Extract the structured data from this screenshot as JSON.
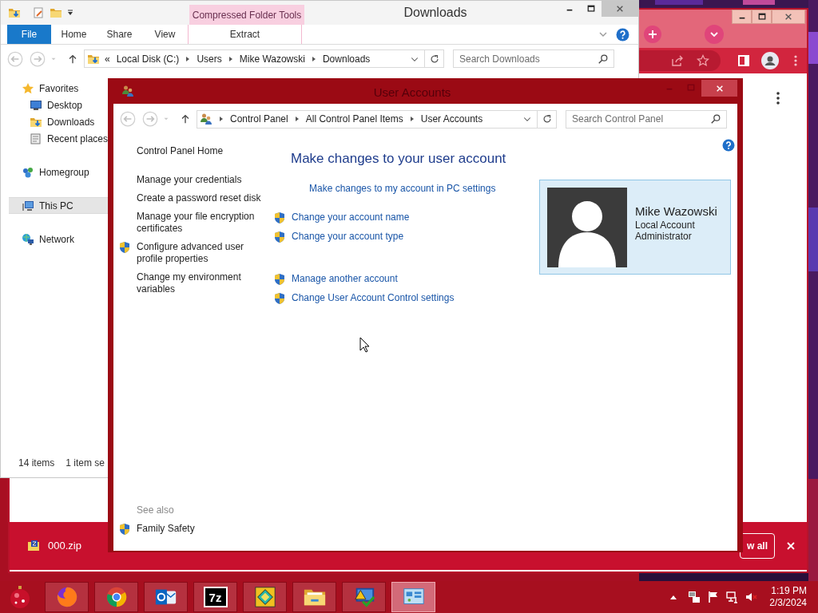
{
  "explorer": {
    "title": "Downloads",
    "contextual_group": "Compressed Folder Tools",
    "ribbon_tabs": [
      {
        "label": "File",
        "kind": "file"
      },
      {
        "label": "Home",
        "kind": "tab"
      },
      {
        "label": "Share",
        "kind": "tab"
      },
      {
        "label": "View",
        "kind": "tab"
      },
      {
        "label": "Extract",
        "kind": "contextual"
      }
    ],
    "address": {
      "overflow": "«",
      "path": [
        "Local Disk (C:)",
        "Users",
        "Mike Wazowski",
        "Downloads"
      ]
    },
    "search": {
      "placeholder": "Search Downloads"
    },
    "nav": [
      {
        "label": "Favorites",
        "kind": "star",
        "selected": false,
        "children": [
          {
            "label": "Desktop",
            "kind": "desktop",
            "selected": false
          },
          {
            "label": "Downloads",
            "kind": "downloads",
            "selected": false
          },
          {
            "label": "Recent places",
            "kind": "recent",
            "selected": false
          }
        ]
      },
      {
        "label": "Homegroup",
        "kind": "homegroup",
        "selected": false
      },
      {
        "label": "This PC",
        "kind": "pc",
        "selected": true
      },
      {
        "label": "Network",
        "kind": "network",
        "selected": false
      }
    ],
    "status": [
      "14 items",
      "1 item se"
    ]
  },
  "browser": {
    "download": {
      "file": "000.zip",
      "button": "w all"
    }
  },
  "user_accounts": {
    "title": "User Accounts",
    "breadcrumb": [
      "Control Panel",
      "All Control Panel Items",
      "User Accounts"
    ],
    "search": {
      "placeholder": "Search Control Panel"
    },
    "tasks": [
      {
        "label": "Control Panel Home",
        "shield": false
      },
      {
        "label": "Manage your credentials",
        "shield": false
      },
      {
        "label": "Create a password reset disk",
        "shield": false
      },
      {
        "label": "Manage your file encryption certificates",
        "shield": false
      },
      {
        "label": "Configure advanced user profile properties",
        "shield": true
      },
      {
        "label": "Change my environment variables",
        "shield": false
      }
    ],
    "heading": "Make changes to your user account",
    "link_groups": [
      [
        {
          "label": "Make changes to my account in PC settings",
          "shield": false
        }
      ],
      [
        {
          "label": "Change your account name",
          "shield": true
        },
        {
          "label": "Change your account type",
          "shield": true
        }
      ],
      [
        {
          "label": "Manage another account",
          "shield": true
        },
        {
          "label": "Change User Account Control settings",
          "shield": true
        }
      ]
    ],
    "account": {
      "name": "Mike Wazowski",
      "details": [
        "Local Account",
        "Administrator"
      ]
    },
    "see_also": {
      "title": "See also",
      "links": [
        {
          "label": "Family Safety",
          "shield": true
        }
      ]
    }
  },
  "taskbar": {
    "apps": [
      {
        "kind": "firefox",
        "selected": false
      },
      {
        "kind": "chrome",
        "selected": false
      },
      {
        "kind": "outlook",
        "selected": false
      },
      {
        "kind": "sevenzip",
        "glyph": "7z",
        "selected": false
      },
      {
        "kind": "game",
        "selected": false
      },
      {
        "kind": "explorer",
        "selected": false
      },
      {
        "kind": "action",
        "selected": false
      },
      {
        "kind": "controlpanel",
        "selected": true
      }
    ],
    "time": "1:19 PM",
    "date": "2/3/2024"
  }
}
